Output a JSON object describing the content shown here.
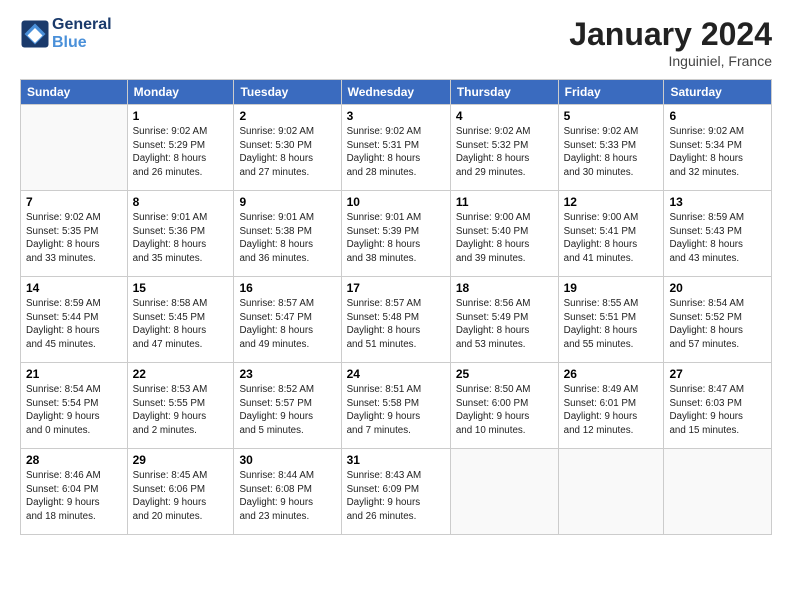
{
  "header": {
    "logo_general": "General",
    "logo_blue": "Blue",
    "title": "January 2024",
    "location": "Inguiniel, France"
  },
  "weekdays": [
    "Sunday",
    "Monday",
    "Tuesday",
    "Wednesday",
    "Thursday",
    "Friday",
    "Saturday"
  ],
  "weeks": [
    [
      {
        "day": "",
        "lines": []
      },
      {
        "day": "1",
        "lines": [
          "Sunrise: 9:02 AM",
          "Sunset: 5:29 PM",
          "Daylight: 8 hours",
          "and 26 minutes."
        ]
      },
      {
        "day": "2",
        "lines": [
          "Sunrise: 9:02 AM",
          "Sunset: 5:30 PM",
          "Daylight: 8 hours",
          "and 27 minutes."
        ]
      },
      {
        "day": "3",
        "lines": [
          "Sunrise: 9:02 AM",
          "Sunset: 5:31 PM",
          "Daylight: 8 hours",
          "and 28 minutes."
        ]
      },
      {
        "day": "4",
        "lines": [
          "Sunrise: 9:02 AM",
          "Sunset: 5:32 PM",
          "Daylight: 8 hours",
          "and 29 minutes."
        ]
      },
      {
        "day": "5",
        "lines": [
          "Sunrise: 9:02 AM",
          "Sunset: 5:33 PM",
          "Daylight: 8 hours",
          "and 30 minutes."
        ]
      },
      {
        "day": "6",
        "lines": [
          "Sunrise: 9:02 AM",
          "Sunset: 5:34 PM",
          "Daylight: 8 hours",
          "and 32 minutes."
        ]
      }
    ],
    [
      {
        "day": "7",
        "lines": [
          "Sunrise: 9:02 AM",
          "Sunset: 5:35 PM",
          "Daylight: 8 hours",
          "and 33 minutes."
        ]
      },
      {
        "day": "8",
        "lines": [
          "Sunrise: 9:01 AM",
          "Sunset: 5:36 PM",
          "Daylight: 8 hours",
          "and 35 minutes."
        ]
      },
      {
        "day": "9",
        "lines": [
          "Sunrise: 9:01 AM",
          "Sunset: 5:38 PM",
          "Daylight: 8 hours",
          "and 36 minutes."
        ]
      },
      {
        "day": "10",
        "lines": [
          "Sunrise: 9:01 AM",
          "Sunset: 5:39 PM",
          "Daylight: 8 hours",
          "and 38 minutes."
        ]
      },
      {
        "day": "11",
        "lines": [
          "Sunrise: 9:00 AM",
          "Sunset: 5:40 PM",
          "Daylight: 8 hours",
          "and 39 minutes."
        ]
      },
      {
        "day": "12",
        "lines": [
          "Sunrise: 9:00 AM",
          "Sunset: 5:41 PM",
          "Daylight: 8 hours",
          "and 41 minutes."
        ]
      },
      {
        "day": "13",
        "lines": [
          "Sunrise: 8:59 AM",
          "Sunset: 5:43 PM",
          "Daylight: 8 hours",
          "and 43 minutes."
        ]
      }
    ],
    [
      {
        "day": "14",
        "lines": [
          "Sunrise: 8:59 AM",
          "Sunset: 5:44 PM",
          "Daylight: 8 hours",
          "and 45 minutes."
        ]
      },
      {
        "day": "15",
        "lines": [
          "Sunrise: 8:58 AM",
          "Sunset: 5:45 PM",
          "Daylight: 8 hours",
          "and 47 minutes."
        ]
      },
      {
        "day": "16",
        "lines": [
          "Sunrise: 8:57 AM",
          "Sunset: 5:47 PM",
          "Daylight: 8 hours",
          "and 49 minutes."
        ]
      },
      {
        "day": "17",
        "lines": [
          "Sunrise: 8:57 AM",
          "Sunset: 5:48 PM",
          "Daylight: 8 hours",
          "and 51 minutes."
        ]
      },
      {
        "day": "18",
        "lines": [
          "Sunrise: 8:56 AM",
          "Sunset: 5:49 PM",
          "Daylight: 8 hours",
          "and 53 minutes."
        ]
      },
      {
        "day": "19",
        "lines": [
          "Sunrise: 8:55 AM",
          "Sunset: 5:51 PM",
          "Daylight: 8 hours",
          "and 55 minutes."
        ]
      },
      {
        "day": "20",
        "lines": [
          "Sunrise: 8:54 AM",
          "Sunset: 5:52 PM",
          "Daylight: 8 hours",
          "and 57 minutes."
        ]
      }
    ],
    [
      {
        "day": "21",
        "lines": [
          "Sunrise: 8:54 AM",
          "Sunset: 5:54 PM",
          "Daylight: 9 hours",
          "and 0 minutes."
        ]
      },
      {
        "day": "22",
        "lines": [
          "Sunrise: 8:53 AM",
          "Sunset: 5:55 PM",
          "Daylight: 9 hours",
          "and 2 minutes."
        ]
      },
      {
        "day": "23",
        "lines": [
          "Sunrise: 8:52 AM",
          "Sunset: 5:57 PM",
          "Daylight: 9 hours",
          "and 5 minutes."
        ]
      },
      {
        "day": "24",
        "lines": [
          "Sunrise: 8:51 AM",
          "Sunset: 5:58 PM",
          "Daylight: 9 hours",
          "and 7 minutes."
        ]
      },
      {
        "day": "25",
        "lines": [
          "Sunrise: 8:50 AM",
          "Sunset: 6:00 PM",
          "Daylight: 9 hours",
          "and 10 minutes."
        ]
      },
      {
        "day": "26",
        "lines": [
          "Sunrise: 8:49 AM",
          "Sunset: 6:01 PM",
          "Daylight: 9 hours",
          "and 12 minutes."
        ]
      },
      {
        "day": "27",
        "lines": [
          "Sunrise: 8:47 AM",
          "Sunset: 6:03 PM",
          "Daylight: 9 hours",
          "and 15 minutes."
        ]
      }
    ],
    [
      {
        "day": "28",
        "lines": [
          "Sunrise: 8:46 AM",
          "Sunset: 6:04 PM",
          "Daylight: 9 hours",
          "and 18 minutes."
        ]
      },
      {
        "day": "29",
        "lines": [
          "Sunrise: 8:45 AM",
          "Sunset: 6:06 PM",
          "Daylight: 9 hours",
          "and 20 minutes."
        ]
      },
      {
        "day": "30",
        "lines": [
          "Sunrise: 8:44 AM",
          "Sunset: 6:08 PM",
          "Daylight: 9 hours",
          "and 23 minutes."
        ]
      },
      {
        "day": "31",
        "lines": [
          "Sunrise: 8:43 AM",
          "Sunset: 6:09 PM",
          "Daylight: 9 hours",
          "and 26 minutes."
        ]
      },
      {
        "day": "",
        "lines": []
      },
      {
        "day": "",
        "lines": []
      },
      {
        "day": "",
        "lines": []
      }
    ]
  ]
}
